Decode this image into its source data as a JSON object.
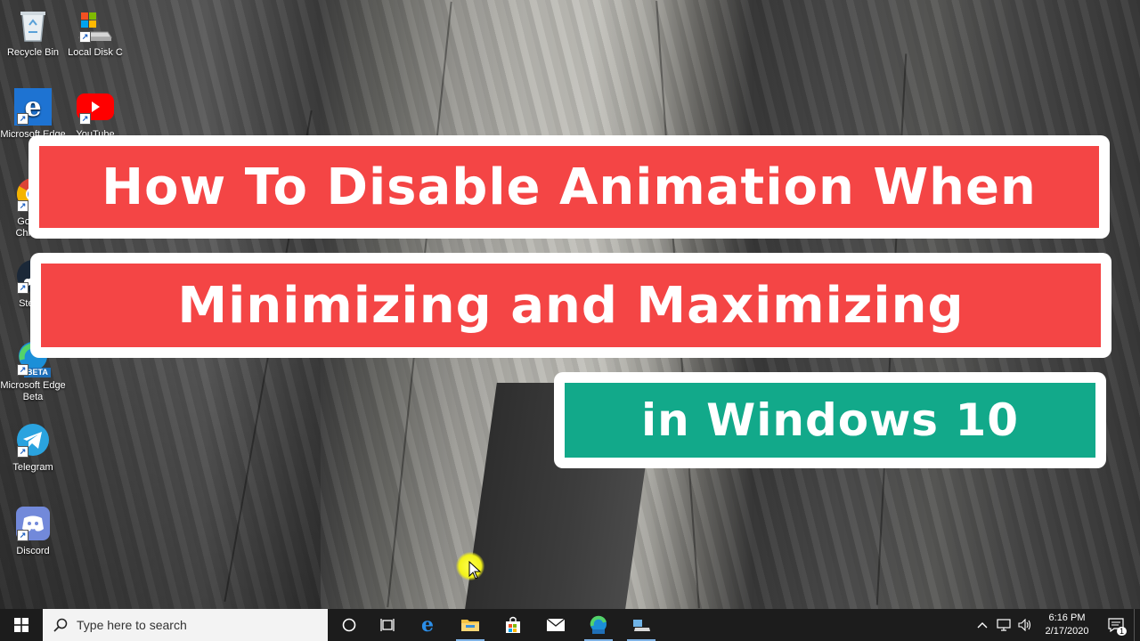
{
  "desktop": {
    "icons": [
      {
        "label": "Recycle Bin",
        "icon": "recycle-bin-icon"
      },
      {
        "label": "Local Disk C",
        "icon": "drive-icon"
      },
      {
        "label": "Microsoft Edge",
        "icon": "edge-icon"
      },
      {
        "label": "YouTube",
        "icon": "youtube-icon"
      },
      {
        "label": "Google Chrome",
        "icon": "chrome-icon"
      },
      {
        "label": "Steam",
        "icon": "steam-icon"
      },
      {
        "label": "Microsoft Edge Beta",
        "icon": "edge-beta-icon",
        "badge": "BETA"
      },
      {
        "label": "Telegram",
        "icon": "telegram-icon"
      },
      {
        "label": "Discord",
        "icon": "discord-icon"
      }
    ]
  },
  "overlay": {
    "line1": "How To Disable Animation When",
    "line2": "Minimizing and Maximizing",
    "line3": "in Windows 10",
    "colors": {
      "red": "#f44545",
      "green": "#12a98a",
      "border": "#ffffff"
    }
  },
  "taskbar": {
    "search_placeholder": "Type here to search",
    "pinned": [
      {
        "name": "cortana",
        "icon": "cortana-circle-icon"
      },
      {
        "name": "task-view",
        "icon": "task-view-icon"
      },
      {
        "name": "edge",
        "icon": "edge-icon"
      },
      {
        "name": "file-explorer",
        "icon": "folder-icon"
      },
      {
        "name": "store",
        "icon": "store-bag-icon"
      },
      {
        "name": "mail",
        "icon": "mail-icon"
      },
      {
        "name": "edge-beta",
        "icon": "edge-beta-icon"
      },
      {
        "name": "disk-tool",
        "icon": "disk-tool-icon"
      }
    ],
    "tray": {
      "time": "6:16 PM",
      "date": "2/17/2020",
      "notification_count": "1"
    }
  }
}
